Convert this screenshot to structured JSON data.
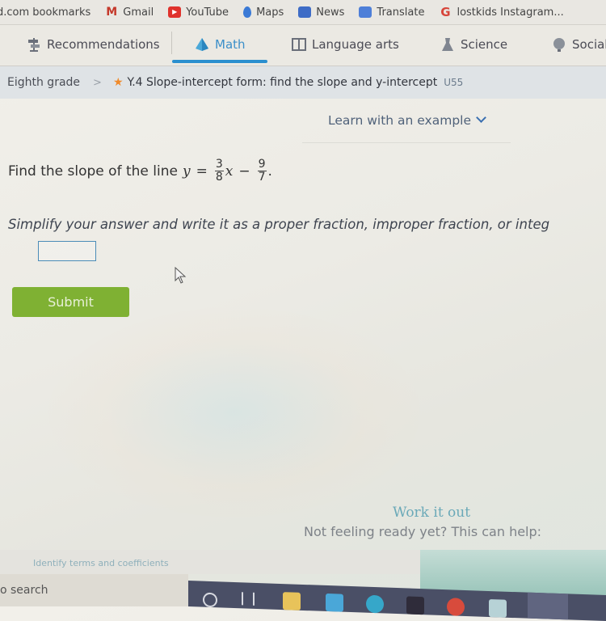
{
  "bookmarks": [
    {
      "label": "d.com bookmarks",
      "icon": "none"
    },
    {
      "label": "Gmail",
      "icon": "gmail-icon"
    },
    {
      "label": "YouTube",
      "icon": "youtube-icon"
    },
    {
      "label": "Maps",
      "icon": "maps-pin-icon"
    },
    {
      "label": "News",
      "icon": "news-icon"
    },
    {
      "label": "Translate",
      "icon": "translate-icon"
    },
    {
      "label": "lostkids Instagram...",
      "icon": "google-icon"
    }
  ],
  "subject_tabs": [
    {
      "label": "Recommendations",
      "icon": "signpost-icon",
      "active": false
    },
    {
      "label": "Math",
      "icon": "pyramid-icon",
      "active": true
    },
    {
      "label": "Language arts",
      "icon": "book-icon",
      "active": false
    },
    {
      "label": "Science",
      "icon": "flask-icon",
      "active": false
    },
    {
      "label": "Social",
      "icon": "globe-icon",
      "active": false
    }
  ],
  "breadcrumb": {
    "grade": "Eighth grade",
    "separator": ">",
    "skill": "Y.4 Slope-intercept form: find the slope and y-intercept",
    "code": "U55"
  },
  "learn_example": {
    "label": "Learn with an example"
  },
  "question": {
    "prefix": "Find the slope of the line",
    "var_y": "y",
    "equals": "=",
    "frac1_num": "3",
    "frac1_den": "8",
    "var_x": "x",
    "minus": "−",
    "frac2_num": "9",
    "frac2_den": "7",
    "period": "."
  },
  "instructions": "Simplify your answer and write it as a proper fraction, improper fraction, or integ",
  "answer": {
    "value": "",
    "placeholder": ""
  },
  "submit": {
    "label": "Submit"
  },
  "help": {
    "title": "Work it out",
    "subtitle": "Not feeling ready yet? This can help:",
    "link": "Identify terms and coefficients"
  },
  "taskbar": {
    "search_text": "o search"
  },
  "colors": {
    "accent_blue": "#2b8fcf",
    "submit_green": "#7fb133",
    "star_orange": "#f08a2a"
  }
}
